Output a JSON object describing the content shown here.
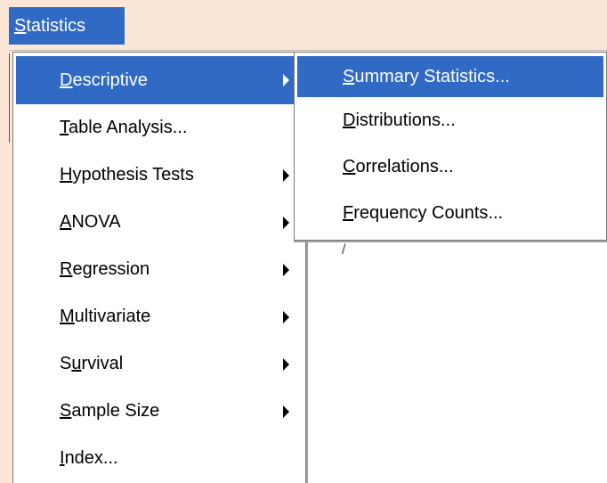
{
  "menubar": {
    "statistics_label": "Statistics",
    "statistics_mnemonic": "S",
    "statistics_rest": "tatistics"
  },
  "statistics_menu": {
    "items": [
      {
        "pre": "",
        "mn": "D",
        "post": "escriptive",
        "has_submenu": true,
        "selected": true
      },
      {
        "pre": "",
        "mn": "T",
        "post": "able Analysis...",
        "has_submenu": false,
        "selected": false
      },
      {
        "pre": "",
        "mn": "H",
        "post": "ypothesis Tests",
        "has_submenu": true,
        "selected": false
      },
      {
        "pre": "",
        "mn": "A",
        "post": "NOVA",
        "has_submenu": true,
        "selected": false
      },
      {
        "pre": "",
        "mn": "R",
        "post": "egression",
        "has_submenu": true,
        "selected": false
      },
      {
        "pre": "",
        "mn": "M",
        "post": "ultivariate",
        "has_submenu": true,
        "selected": false
      },
      {
        "pre": "S",
        "mn": "u",
        "post": "rvival",
        "has_submenu": true,
        "selected": false
      },
      {
        "pre": "",
        "mn": "S",
        "post": "ample Size",
        "has_submenu": true,
        "selected": false
      },
      {
        "pre": "",
        "mn": "I",
        "post": "ndex...",
        "has_submenu": false,
        "selected": false
      }
    ]
  },
  "descriptive_submenu": {
    "items": [
      {
        "pre": "",
        "mn": "S",
        "post": "ummary Statistics...",
        "selected": true
      },
      {
        "pre": "",
        "mn": "D",
        "post": "istributions...",
        "selected": false
      },
      {
        "pre": "",
        "mn": "C",
        "post": "orrelations...",
        "selected": false
      },
      {
        "pre": "",
        "mn": "F",
        "post": "requency Counts...",
        "selected": false
      }
    ]
  },
  "underlay": {
    "mark": "/"
  },
  "colors": {
    "highlight": "#316ac5",
    "background": "#fbe6d8",
    "menu_bg": "#ffffff"
  }
}
